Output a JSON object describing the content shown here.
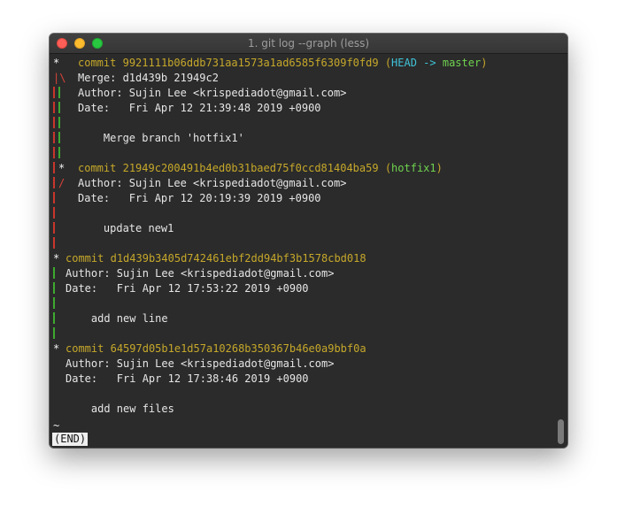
{
  "window": {
    "title": "1. git log --graph (less)"
  },
  "colors": {
    "commit_hash": "#c6a82a",
    "graph_red": "#d9453a",
    "graph_green": "#4cbf3f",
    "head_label": "#3fc3d8",
    "branch_label": "#6fd34f"
  },
  "log": {
    "c1": {
      "graph_star": "*",
      "commit_word": "commit",
      "hash": "9921111b06ddb731aa1573a1ad6585f6309f0fd9",
      "ref_open": "(",
      "head": "HEAD",
      "arrow": " -> ",
      "branch": "master",
      "ref_close": ")",
      "merge_graph": "|\\",
      "merge_line": "Merge: d1d439b 21949c2",
      "author_line": "Author: Sujin Lee <krispediadot@gmail.com>",
      "date_line": "Date:   Fri Apr 12 21:39:48 2019 +0900",
      "message": "Merge branch 'hotfix1'"
    },
    "c2": {
      "graph_star": "*",
      "commit_word": "commit",
      "hash": "21949c200491b4ed0b31baed75f0ccd81404ba59",
      "ref_open": "(",
      "branch": "hotfix1",
      "ref_close": ")",
      "slash_graph": "/",
      "author_line": "Author: Sujin Lee <krispediadot@gmail.com>",
      "date_line": "Date:   Fri Apr 12 20:19:39 2019 +0900",
      "message": "update new1"
    },
    "c3": {
      "graph_star": "*",
      "commit_word": "commit",
      "hash": "d1d439b3405d742461ebf2dd94bf3b1578cbd018",
      "author_line": "Author: Sujin Lee <krispediadot@gmail.com>",
      "date_line": "Date:   Fri Apr 12 17:53:22 2019 +0900",
      "message": "add new line"
    },
    "c4": {
      "graph_star": "*",
      "commit_word": "commit",
      "hash": "64597d05b1e1d57a10268b350367b46e0a9bbf0a",
      "author_line": "Author: Sujin Lee <krispediadot@gmail.com>",
      "date_line": "Date:   Fri Apr 12 17:38:46 2019 +0900",
      "message": "add new files"
    },
    "tilde": "~",
    "status": "(END)"
  }
}
